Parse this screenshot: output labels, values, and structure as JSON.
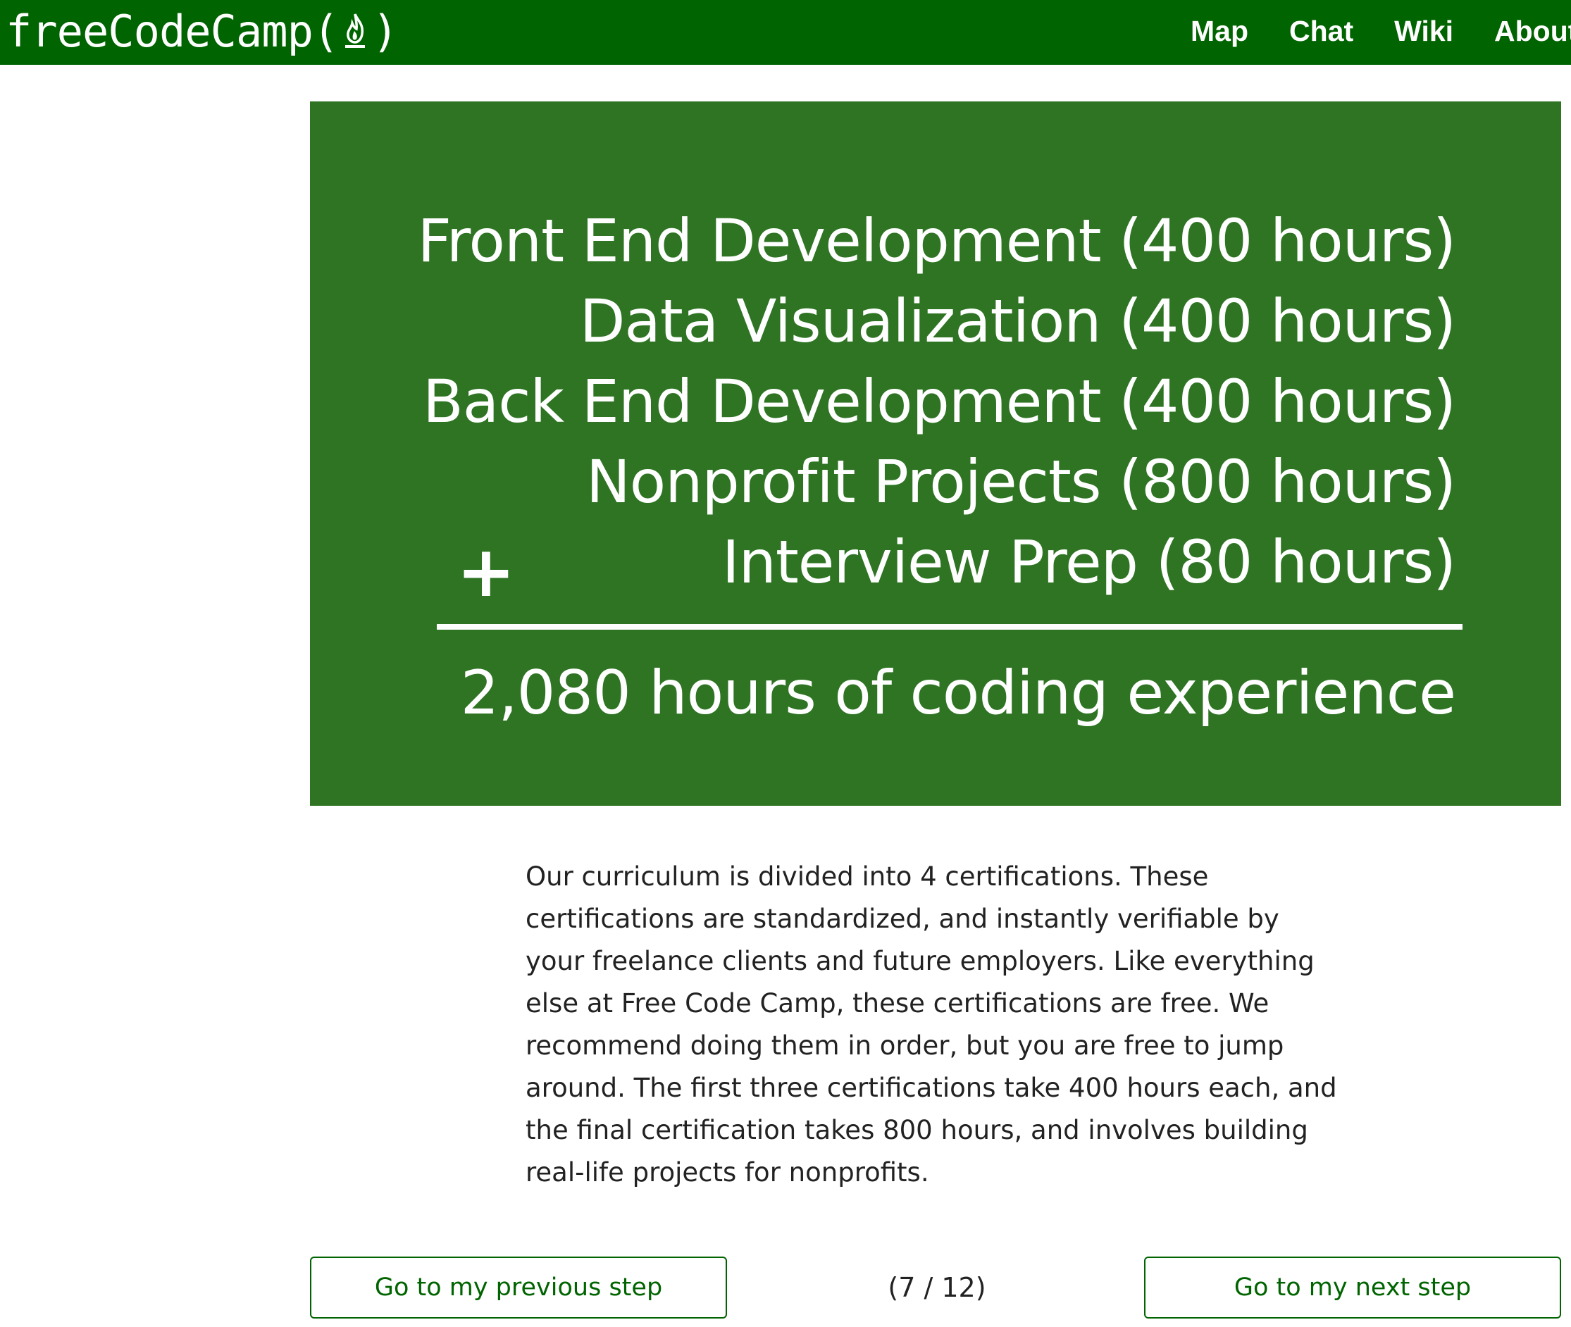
{
  "navbar": {
    "brand_text": "freeCodeCamp",
    "brand_open": "(",
    "brand_close": ")",
    "links": [
      {
        "label": "Map"
      },
      {
        "label": "Chat"
      },
      {
        "label": "Wiki"
      },
      {
        "label": "About"
      }
    ],
    "background_color": "#006400"
  },
  "hero": {
    "background_color": "#2e7423",
    "lines": [
      "Front End Development (400 hours)",
      "Data Visualization (400 hours)",
      "Back End Development (400 hours)",
      "Nonprofit Projects (800 hours)",
      "Interview Prep (80 hours)"
    ],
    "plus_sign": "+",
    "total": "2,080 hours of coding experience"
  },
  "description": "Our curriculum is divided into 4 certifications. These certifications are standardized, and instantly verifiable by your freelance clients and future employers. Like everything else at Free Code Camp, these certifications are free. We recommend doing them in order, but you are free to jump around. The first three certifications take 400 hours each, and the final certification takes 800 hours, and involves building real-life projects for nonprofits.",
  "pager": {
    "prev_label": "Go to my previous step",
    "counter": "(7 / 12)",
    "next_label": "Go to my next step"
  }
}
